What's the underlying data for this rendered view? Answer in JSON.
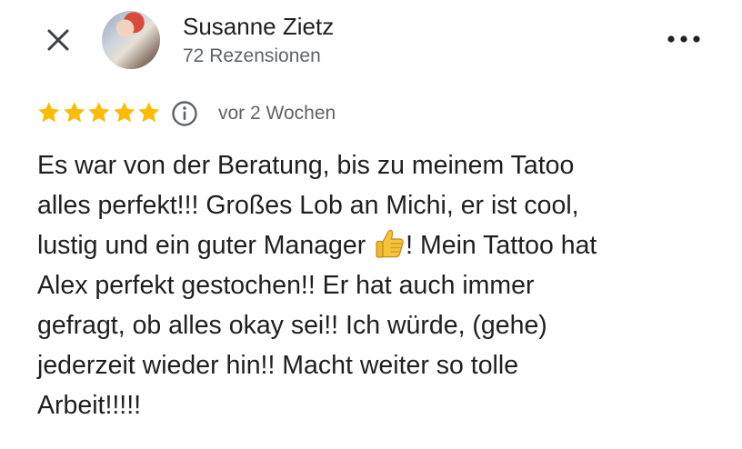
{
  "header": {
    "close_icon": "close-icon",
    "reviewer_name": "Susanne Zietz",
    "review_count": "72 Rezensionen",
    "more_icon": "more-horizontal-icon"
  },
  "review": {
    "rating": 5,
    "rating_max": 5,
    "star_color": "#fbbc04",
    "info_icon": "info-icon",
    "time_ago": "vor 2 Wochen",
    "lines": [
      "Es war von der Beratung, bis zu meinem Tatoo",
      "alles perfekt!!! Großes Lob an Michi, er ist cool,",
      "lustig und ein guter Manager",
      "! Mein Tattoo hat",
      "Alex perfekt gestochen!! Er hat auch immer",
      "gefragt, ob alles okay sei!! Ich würde, (gehe)",
      "jederzeit wieder hin!! Macht weiter so tolle",
      "Arbeit!!!!!"
    ],
    "emoji": "thumbs-up-emoji"
  }
}
